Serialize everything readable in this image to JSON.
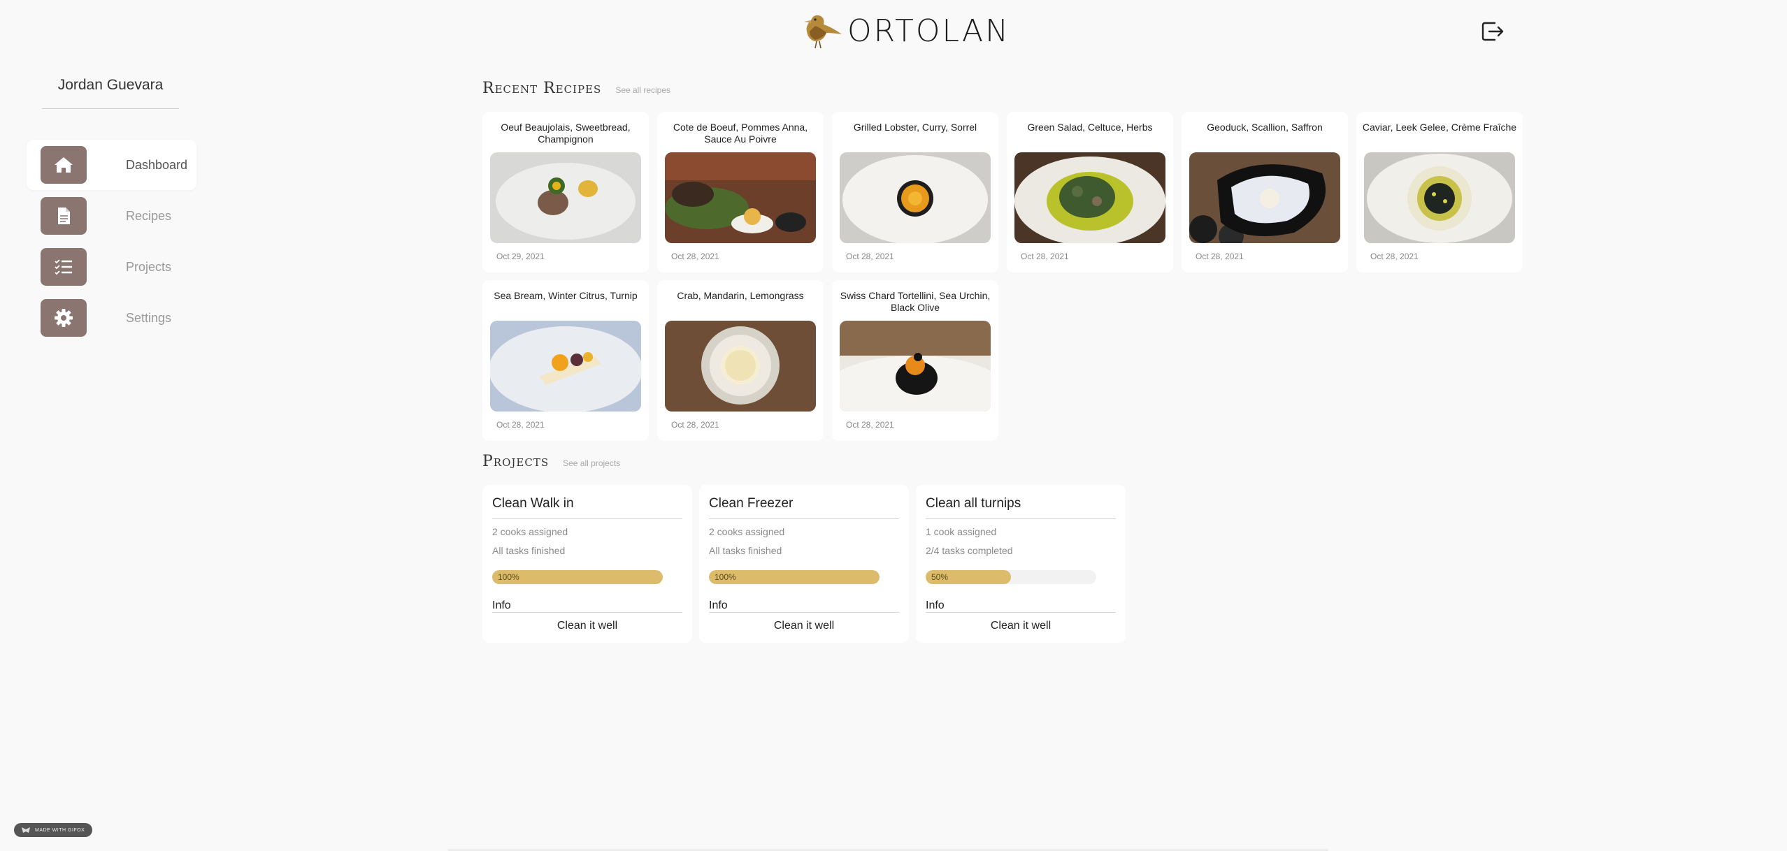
{
  "header": {
    "brand": "ORTOLAN",
    "logout_icon": "logout-icon"
  },
  "sidebar": {
    "user_name": "Jordan Guevara",
    "items": [
      {
        "label": "Dashboard",
        "icon": "home-icon",
        "active": true
      },
      {
        "label": "Recipes",
        "icon": "document-icon",
        "active": false
      },
      {
        "label": "Projects",
        "icon": "checklist-icon",
        "active": false
      },
      {
        "label": "Settings",
        "icon": "gear-icon",
        "active": false
      }
    ]
  },
  "recipes_section": {
    "title": "Recent Recipes",
    "link": "See all recipes",
    "items": [
      {
        "title": "Oeuf Beaujolais, Sweetbread, Champignon",
        "date": "Oct 29, 2021"
      },
      {
        "title": "Cote de Boeuf, Pommes Anna, Sauce Au Poivre",
        "date": "Oct 28, 2021"
      },
      {
        "title": "Grilled Lobster, Curry, Sorrel",
        "date": "Oct 28, 2021"
      },
      {
        "title": "Green Salad, Celtuce, Herbs",
        "date": "Oct 28, 2021"
      },
      {
        "title": "Geoduck, Scallion, Saffron",
        "date": "Oct 28, 2021"
      },
      {
        "title": "Caviar, Leek Gelee, Crème Fraîche",
        "date": "Oct 28, 2021"
      },
      {
        "title": "Sea Bream, Winter Citrus, Turnip",
        "date": "Oct 28, 2021"
      },
      {
        "title": "Crab, Mandarin, Lemongrass",
        "date": "Oct 28, 2021"
      },
      {
        "title": "Swiss Chard Tortellini, Sea Urchin, Black Olive",
        "date": "Oct 28, 2021"
      }
    ]
  },
  "projects_section": {
    "title": "Projects",
    "link": "See all projects",
    "items": [
      {
        "title": "Clean Walk in",
        "assigned": "2 cooks assigned",
        "status": "All tasks finished",
        "progress": 100,
        "progress_label": "100%",
        "info_label": "Info",
        "description": "Clean it well"
      },
      {
        "title": "Clean Freezer",
        "assigned": "2 cooks assigned",
        "status": "All tasks finished",
        "progress": 100,
        "progress_label": "100%",
        "info_label": "Info",
        "description": "Clean it well"
      },
      {
        "title": "Clean all turnips",
        "assigned": "1 cook assigned",
        "status": "2/4 tasks completed",
        "progress": 50,
        "progress_label": "50%",
        "info_label": "Info",
        "description": "Clean it well"
      }
    ]
  },
  "footer": {
    "badge": "MADE WITH GIFOX"
  },
  "colors": {
    "background": "#f9f9f9",
    "nav_icon_bg": "#8a7571",
    "progress_fill": "#dcbc6a",
    "progress_track": "#f2f2f2"
  }
}
